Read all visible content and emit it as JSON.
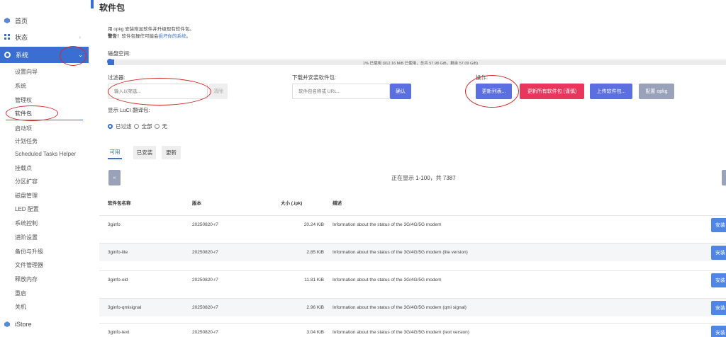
{
  "sidebar": {
    "top_items": [
      {
        "label": "首页",
        "icon": "store-icon"
      },
      {
        "label": "状态",
        "icon": "dashboard-icon"
      }
    ],
    "active_item": {
      "label": "系统",
      "icon": "gear-icon"
    },
    "sub_items": [
      "设置向导",
      "系统",
      "管理权",
      "软件包",
      "启动项",
      "计划任务",
      "Scheduled Tasks Helper",
      "挂载点",
      "分区扩容",
      "磁盘管理",
      "LED 配置",
      "系统控制",
      "进阶设置",
      "备份与升级",
      "文件管理器",
      "释放内存",
      "重启",
      "关机"
    ],
    "bottom_item": {
      "label": "iStore",
      "icon": "store-icon"
    },
    "chevron_right": "›",
    "chevron_down": "⌄"
  },
  "page": {
    "title": "软件包",
    "desc": "用 opkg 安装附加软件并升级现有软件包。",
    "warn_prefix": "警告！",
    "warn_text": "软件包操作可能会",
    "warn_link": "损坏你的系统",
    "warn_suffix": "。"
  },
  "disk": {
    "label": "磁盘空间:",
    "usage_text": "1% 已使用 (912.16 MiB 已使用，总共 57.98 GiB，剩余 57.09 GiB)",
    "used_fraction": 0.01
  },
  "filter": {
    "label": "过滤器:",
    "placeholder": "输入以筛选...",
    "clear_label": "清除"
  },
  "download": {
    "label": "下载并安装软件包:",
    "placeholder": "软件包名称或 URL...",
    "ok_label": "确认"
  },
  "actions": {
    "label": "操作:",
    "update_lists": "更新列表...",
    "upgrade_all": "更新所有软件包 (谨慎)",
    "upload": "上传软件包...",
    "configure": "配置 opkg"
  },
  "luci": {
    "label": "显示 LuCI 翻译包:",
    "options": [
      "已过滤",
      "全部",
      "无"
    ],
    "selected": "已过滤"
  },
  "tabs": [
    "可用",
    "已安装",
    "更新"
  ],
  "pager": {
    "prev": "«",
    "text": "正在显示 1-100，共 7387"
  },
  "table": {
    "headers": [
      "软件包名称",
      "版本",
      "大小 (.ipk)",
      "描述"
    ],
    "install_label": "安装",
    "rows": [
      {
        "name": "3ginfo",
        "version": "20250820-r7",
        "size": "20.24 KiB",
        "desc": "Information about the status of the 3G/4G/5G modem"
      },
      {
        "name": "3ginfo-lite",
        "version": "20250820-r7",
        "size": "2.85 KiB",
        "desc": "Information about the status of the 3G/4G/5G modem (lite version)"
      },
      {
        "name": "3ginfo-old",
        "version": "20250820-r7",
        "size": "11.81 KiB",
        "desc": "Information about the status of the 3G/4G/5G modem"
      },
      {
        "name": "3ginfo-qmisignal",
        "version": "20250820-r7",
        "size": "2.96 KiB",
        "desc": "Information about the status of the 3G/4G/5G modem (qmi signal)"
      },
      {
        "name": "3ginfo-text",
        "version": "20250820-r7",
        "size": "3.04 KiB",
        "desc": "Information about the status of the 3G/4G/5G modem (text version)"
      }
    ]
  },
  "colors": {
    "accent": "#3a6fd1",
    "danger": "#e8365d",
    "primary_button": "#5b6fe0",
    "annotation": "#d62828"
  }
}
